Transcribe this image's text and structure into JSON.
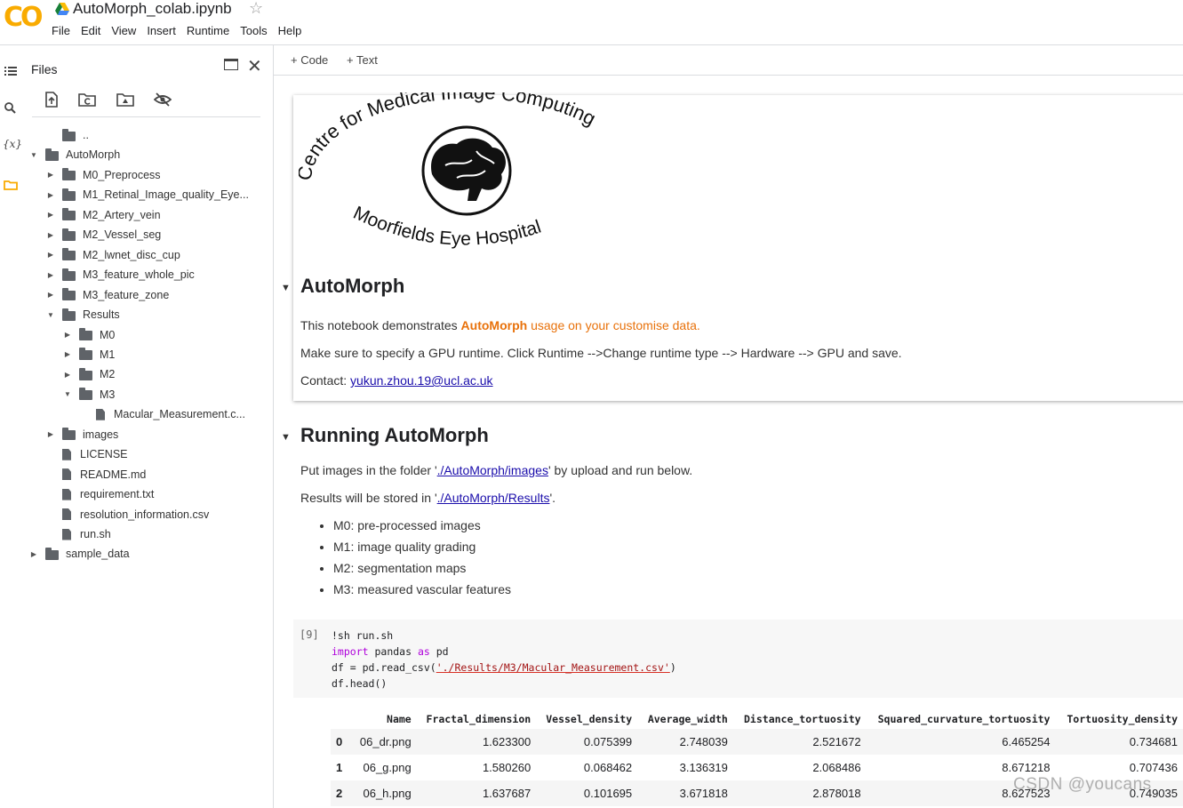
{
  "app": {
    "logo": "CO",
    "notebook_title": "AutoMorph_colab.ipynb"
  },
  "menu": [
    "File",
    "Edit",
    "View",
    "Insert",
    "Runtime",
    "Tools",
    "Help"
  ],
  "files_panel": {
    "title": "Files",
    "tree": [
      {
        "label": "..",
        "kind": "up"
      },
      {
        "label": "AutoMorph",
        "kind": "folder",
        "expanded": true,
        "depth": 0
      },
      {
        "label": "M0_Preprocess",
        "kind": "folder",
        "expanded": false,
        "depth": 1
      },
      {
        "label": "M1_Retinal_Image_quality_Eye...",
        "kind": "folder",
        "expanded": false,
        "depth": 1
      },
      {
        "label": "M2_Artery_vein",
        "kind": "folder",
        "expanded": false,
        "depth": 1
      },
      {
        "label": "M2_Vessel_seg",
        "kind": "folder",
        "expanded": false,
        "depth": 1
      },
      {
        "label": "M2_lwnet_disc_cup",
        "kind": "folder",
        "expanded": false,
        "depth": 1
      },
      {
        "label": "M3_feature_whole_pic",
        "kind": "folder",
        "expanded": false,
        "depth": 1
      },
      {
        "label": "M3_feature_zone",
        "kind": "folder",
        "expanded": false,
        "depth": 1
      },
      {
        "label": "Results",
        "kind": "folder",
        "expanded": true,
        "depth": 1
      },
      {
        "label": "M0",
        "kind": "folder",
        "expanded": false,
        "depth": 2
      },
      {
        "label": "M1",
        "kind": "folder",
        "expanded": false,
        "depth": 2
      },
      {
        "label": "M2",
        "kind": "folder",
        "expanded": false,
        "depth": 2
      },
      {
        "label": "M3",
        "kind": "folder",
        "expanded": true,
        "depth": 2
      },
      {
        "label": "Macular_Measurement.c...",
        "kind": "file",
        "depth": 3
      },
      {
        "label": "images",
        "kind": "folder",
        "expanded": false,
        "depth": 1
      },
      {
        "label": "LICENSE",
        "kind": "file",
        "depth": 1
      },
      {
        "label": "README.md",
        "kind": "file",
        "depth": 1
      },
      {
        "label": "requirement.txt",
        "kind": "file",
        "depth": 1
      },
      {
        "label": "resolution_information.csv",
        "kind": "file",
        "depth": 1
      },
      {
        "label": "run.sh",
        "kind": "file",
        "depth": 1
      },
      {
        "label": "sample_data",
        "kind": "folder",
        "expanded": false,
        "depth": 0
      }
    ]
  },
  "toolbar": {
    "code_label": "+ Code",
    "text_label": "+ Text"
  },
  "header_image": {
    "arc_top": "Centre for Medical Image Computing",
    "arc_bottom": "Moorfields Eye Hospital"
  },
  "section_automorph": {
    "title": "AutoMorph",
    "intro_prefix": "This notebook demonstrates ",
    "intro_bold": "AutoMorph",
    "intro_suffix": " usage on your customise data.",
    "runtime_note": "Make sure to specify a GPU runtime. Click Runtime -->Change runtime type --> Hardware --> GPU and save.",
    "contact_label": "Contact: ",
    "contact_email": "yukun.zhou.19@ucl.ac.uk"
  },
  "section_running": {
    "title": "Running AutoMorph",
    "put_prefix": "Put images in the folder '",
    "put_link": "./AutoMorph/images",
    "put_suffix": "' by upload and run below.",
    "results_prefix": "Results will be stored in '",
    "results_link": "./AutoMorph/Results",
    "results_suffix": "'.",
    "bullets": [
      "M0: pre-processed images",
      "M1: image quality grading",
      "M2: segmentation maps",
      "M3: measured vascular features"
    ]
  },
  "code_cell": {
    "exec_count": "[9]",
    "line1": "!sh run.sh",
    "line2_kw1": "import",
    "line2_mid": " pandas ",
    "line2_kw2": "as",
    "line2_end": " pd",
    "line3_prefix": "df = pd.read_csv(",
    "line3_str": "'./Results/M3/Macular_Measurement.csv'",
    "line3_suffix": ")",
    "line4": "df.head()"
  },
  "output_table": {
    "columns": [
      "",
      "Name",
      "Fractal_dimension",
      "Vessel_density",
      "Average_width",
      "Distance_tortuosity",
      "Squared_curvature_tortuosity",
      "Tortuosity_density"
    ],
    "rows": [
      [
        "0",
        "06_dr.png",
        "1.623300",
        "0.075399",
        "2.748039",
        "2.521672",
        "6.465254",
        "0.734681"
      ],
      [
        "1",
        "06_g.png",
        "1.580260",
        "0.068462",
        "3.136319",
        "2.068486",
        "8.671218",
        "0.707436"
      ],
      [
        "2",
        "06_h.png",
        "1.637687",
        "0.101695",
        "3.671818",
        "2.878018",
        "8.627523",
        "0.749035"
      ]
    ]
  },
  "watermark": "CSDN @youcans",
  "colors": {
    "accent_orange": "#e8710a",
    "colab_logo": "#f9ab00",
    "link": "#1a0dab"
  }
}
